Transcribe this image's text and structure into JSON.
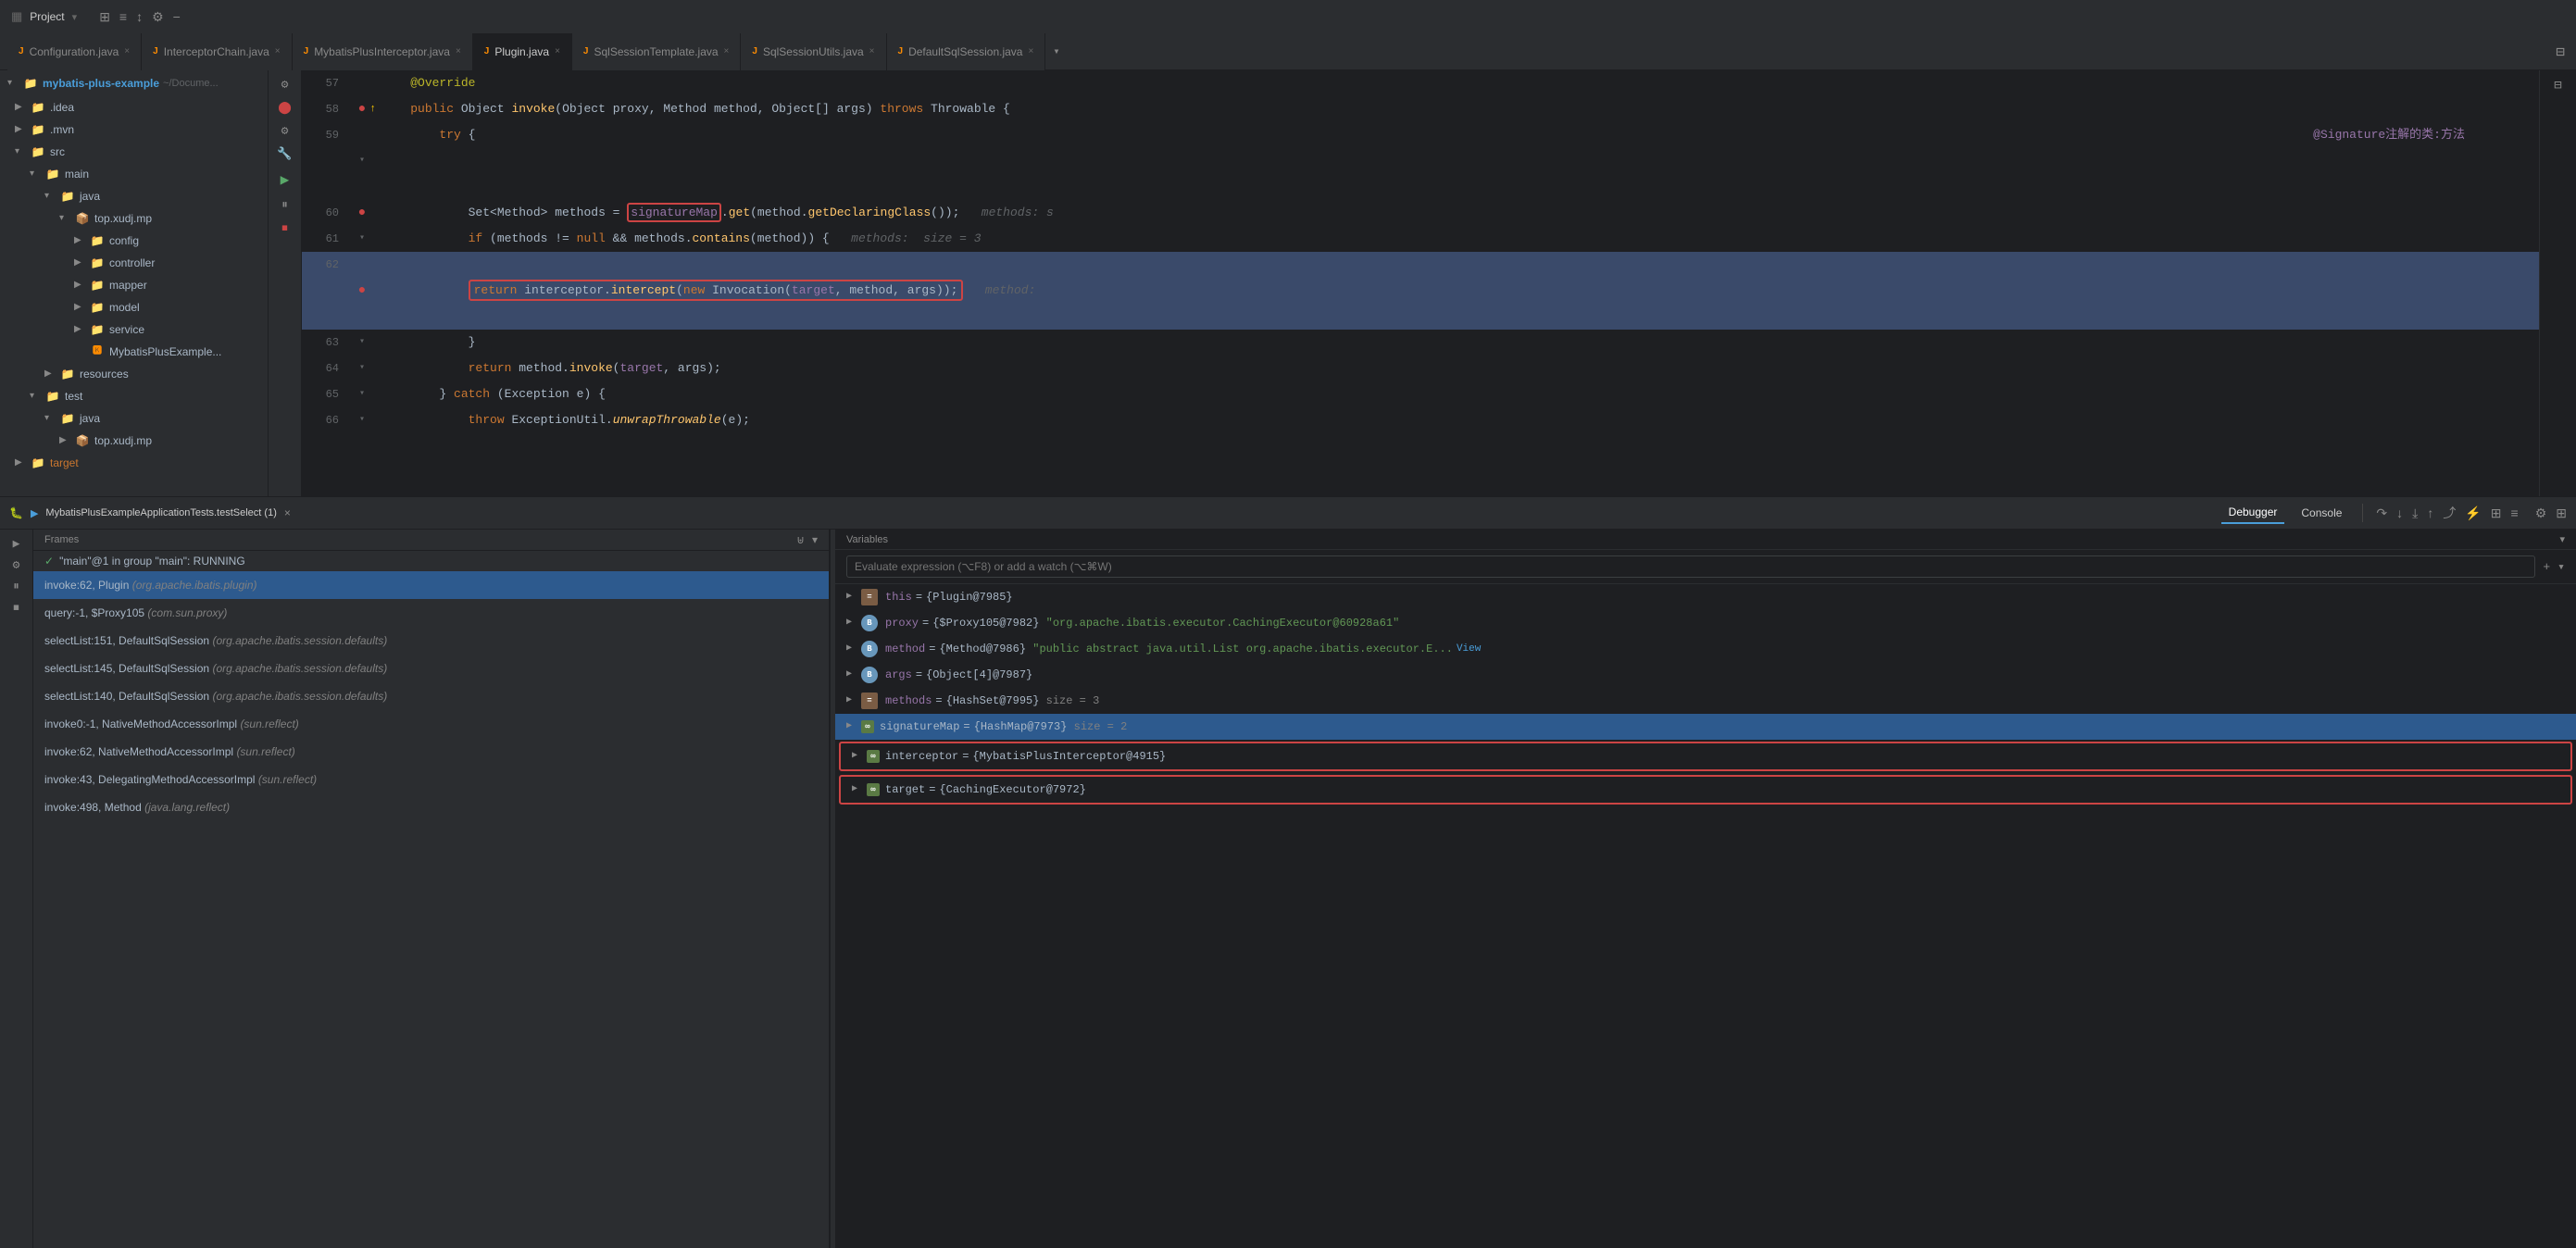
{
  "titlebar": {
    "project_label": "Project",
    "icons": [
      "⊞",
      "≡",
      "↕",
      "⚙",
      "−"
    ]
  },
  "tabs": [
    {
      "id": "config",
      "label": "Configuration.java",
      "active": false,
      "color": "#fe8c02"
    },
    {
      "id": "interceptorchain",
      "label": "InterceptorChain.java",
      "active": false,
      "color": "#fe8c02"
    },
    {
      "id": "mybatisplus",
      "label": "MybatisPlusInterceptor.java",
      "active": false,
      "color": "#fe8c02"
    },
    {
      "id": "plugin",
      "label": "Plugin.java",
      "active": true,
      "color": "#fe8c02"
    },
    {
      "id": "sqlsessiontemplate",
      "label": "SqlSessionTemplate.java",
      "active": false,
      "color": "#fe8c02"
    },
    {
      "id": "sqlsessionutils",
      "label": "SqlSessionUtils.java",
      "active": false,
      "color": "#fe8c02"
    },
    {
      "id": "defaultsqlsession",
      "label": "DefaultSqlSession.java",
      "active": false,
      "color": "#fe8c02"
    }
  ],
  "sidebar": {
    "project_name": "mybatis-plus-example",
    "project_path": "~/Docume...",
    "items": [
      {
        "id": "idea",
        "label": ".idea",
        "indent": 16,
        "type": "folder"
      },
      {
        "id": "mvn",
        "label": ".mvn",
        "indent": 16,
        "type": "folder"
      },
      {
        "id": "src",
        "label": "src",
        "indent": 16,
        "type": "folder",
        "expanded": true
      },
      {
        "id": "main",
        "label": "main",
        "indent": 32,
        "type": "folder",
        "expanded": true
      },
      {
        "id": "java",
        "label": "java",
        "indent": 48,
        "type": "folder",
        "expanded": true
      },
      {
        "id": "top.xudj.mp",
        "label": "top.xudj.mp",
        "indent": 64,
        "type": "package",
        "expanded": true
      },
      {
        "id": "config",
        "label": "config",
        "indent": 80,
        "type": "folder"
      },
      {
        "id": "controller",
        "label": "controller",
        "indent": 80,
        "type": "folder"
      },
      {
        "id": "mapper",
        "label": "mapper",
        "indent": 80,
        "type": "folder"
      },
      {
        "id": "model",
        "label": "model",
        "indent": 80,
        "type": "folder"
      },
      {
        "id": "service",
        "label": "service",
        "indent": 80,
        "type": "folder"
      },
      {
        "id": "MybatisPlusExample",
        "label": "MybatisPlusExample...",
        "indent": 80,
        "type": "java"
      },
      {
        "id": "resources",
        "label": "resources",
        "indent": 48,
        "type": "folder"
      },
      {
        "id": "test",
        "label": "test",
        "indent": 32,
        "type": "folder",
        "expanded": true
      },
      {
        "id": "test-java",
        "label": "java",
        "indent": 48,
        "type": "folder",
        "expanded": true
      },
      {
        "id": "top.xudj.mp2",
        "label": "top.xudj.mp",
        "indent": 64,
        "type": "package"
      },
      {
        "id": "target",
        "label": "target",
        "indent": 16,
        "type": "folder",
        "color": "orange"
      }
    ]
  },
  "code": {
    "lines": [
      {
        "num": "57",
        "content": "@Override",
        "type": "annotation"
      },
      {
        "num": "58",
        "content": "public Object invoke(Object proxy, Method method, Object[] args) throws Throwable {",
        "has_breakpoint": true,
        "has_arrow": true
      },
      {
        "num": "59",
        "content": "    try {",
        "has_fold": true,
        "annotation": "@Signature注解的类:方法"
      },
      {
        "num": "60",
        "content": "        Set<Method> methods = signatureMap.get(method.getDeclaringClass());",
        "has_breakpoint": true,
        "has_red_box": true,
        "inline_comment": "methods: s"
      },
      {
        "num": "61",
        "content": "        if (methods != null && methods.contains(method)) {",
        "has_fold": true,
        "inline_comment": "methods:  size = 3"
      },
      {
        "num": "62",
        "content": "            return interceptor.intercept(new Invocation(target, method, args));",
        "active": true,
        "has_breakpoint": true,
        "has_red_border": true,
        "inline_comment": "method:"
      },
      {
        "num": "63",
        "content": "        }",
        "has_fold": true
      },
      {
        "num": "64",
        "content": "        return method.invoke(target, args);",
        "has_fold": true
      },
      {
        "num": "65",
        "content": "    } catch (Exception e) {",
        "has_fold": true
      },
      {
        "num": "66",
        "content": "        throw ExceptionUtil.unwrapThrowable(e);",
        "has_fold": true
      }
    ]
  },
  "debug_bar": {
    "session_label": "MybatisPlusExampleApplicationTests.testSelect (1)",
    "close": "×",
    "tabs": [
      "Debugger",
      "Console"
    ],
    "toolbar_icons": [
      "≡⇅",
      "↑↑",
      "↓",
      "↓↓",
      "↑",
      "↺",
      "⚡",
      "⊞",
      "≡"
    ],
    "gear_icon": "⚙",
    "settings_icon": "⊞"
  },
  "frames": {
    "header": "Frames",
    "status": "\"main\"@1 in group \"main\": RUNNING",
    "items": [
      {
        "id": "invoke62",
        "label": "invoke:62, Plugin",
        "pkg": "(org.apache.ibatis.plugin)",
        "active": true
      },
      {
        "id": "query-1",
        "label": "query:-1, $Proxy105",
        "pkg": "(com.sun.proxy)",
        "active": false
      },
      {
        "id": "selectlist151",
        "label": "selectList:151, DefaultSqlSession",
        "pkg": "(org.apache.ibatis.session.defaults)",
        "active": false
      },
      {
        "id": "selectlist145",
        "label": "selectList:145, DefaultSqlSession",
        "pkg": "(org.apache.ibatis.session.defaults)",
        "active": false
      },
      {
        "id": "selectlist140",
        "label": "selectList:140, DefaultSqlSession",
        "pkg": "(org.apache.ibatis.session.defaults)",
        "active": false
      },
      {
        "id": "invoke0",
        "label": "invoke0:-1, NativeMethodAccessorImpl",
        "pkg": "(sun.reflect)",
        "active": false
      },
      {
        "id": "invoke62b",
        "label": "invoke:62, NativeMethodAccessorImpl",
        "pkg": "(sun.reflect)",
        "active": false
      },
      {
        "id": "invoke43",
        "label": "invoke:43, DelegatingMethodAccessorImpl",
        "pkg": "(sun.reflect)",
        "active": false
      },
      {
        "id": "invoke498",
        "label": "invoke:498, Method",
        "pkg": "(java.lang.reflect)",
        "active": false
      }
    ]
  },
  "variables": {
    "header": "Variables",
    "search_placeholder": "Evaluate expression (⌥F8) or add a watch (⌥⌘W)",
    "items": [
      {
        "id": "this",
        "name": "this",
        "value": "= {Plugin@7985}",
        "type": "",
        "icon": "eq",
        "expanded": false
      },
      {
        "id": "proxy",
        "name": "proxy",
        "value": "= {$Proxy105@7982} \"org.apache.ibatis.executor.CachingExecutor@60928a61\"",
        "type": "",
        "icon": "circle-b",
        "expanded": false
      },
      {
        "id": "method",
        "name": "method",
        "value": "= {Method@7986} \"public abstract java.util.List org.apache.ibatis.executor.E...",
        "type": "",
        "icon": "circle-b",
        "expanded": false,
        "has_view": true
      },
      {
        "id": "args",
        "name": "args",
        "value": "= {Object[4]@7987}",
        "type": "",
        "icon": "circle-b",
        "expanded": false
      },
      {
        "id": "methods",
        "name": "methods",
        "value": "= {HashSet@7995}  size = 3",
        "type": "",
        "icon": "eq",
        "expanded": false
      },
      {
        "id": "signatureMap",
        "name": "signatureMap",
        "value": "= {HashMap@7973}  size = 2",
        "type": "",
        "icon": "eq",
        "expanded": false,
        "selected": true
      },
      {
        "id": "interceptor",
        "name": "interceptor",
        "value": "= {MybatisPlusInterceptor@4915}",
        "type": "",
        "icon": "eq",
        "expanded": false,
        "red_border": true
      },
      {
        "id": "target",
        "name": "target",
        "value": "= {CachingExecutor@7972}",
        "type": "",
        "icon": "eq",
        "expanded": false,
        "red_border": true
      }
    ]
  },
  "left_toolbar": {
    "icons": [
      "⚙",
      "🔴",
      "⚙",
      "🔧",
      "▶",
      "⏸",
      "⏹"
    ]
  }
}
